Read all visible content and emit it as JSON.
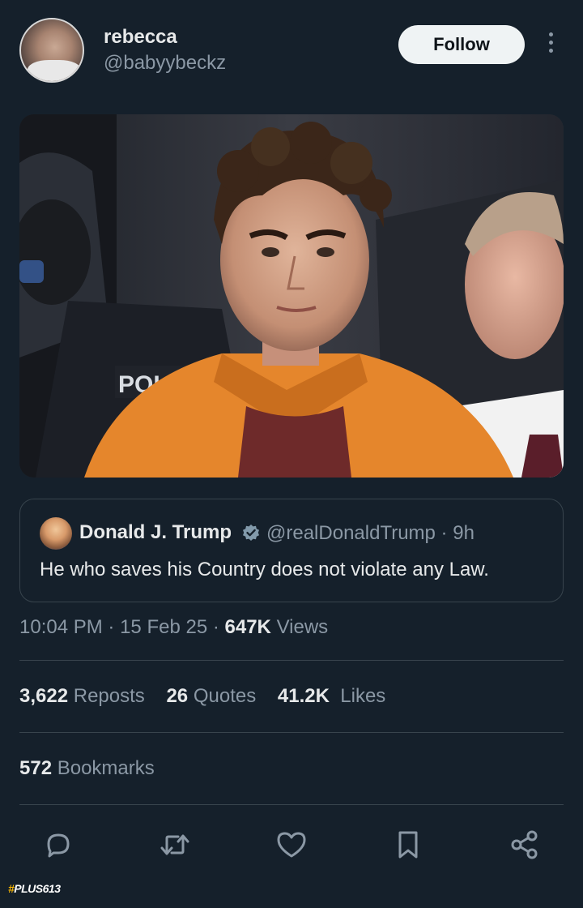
{
  "author": {
    "name": "rebecca",
    "handle": "@babyybeckz",
    "follow_label": "Follow"
  },
  "quoted": {
    "name": "Donald J. Trump",
    "handle": "@realDonaldTrump · 9h",
    "text": "He who saves his Country does not violate any Law."
  },
  "meta": {
    "time": "10:04 PM",
    "date": "15 Feb 25",
    "views_count": "647K",
    "views_label": "Views"
  },
  "stats": {
    "reposts_count": "3,622",
    "reposts_label": "Reposts",
    "quotes_count": "26",
    "quotes_label": "Quotes",
    "likes_count": "41.2K",
    "likes_label": "Likes",
    "bookmarks_count": "572",
    "bookmarks_label": "Bookmarks"
  },
  "media": {
    "badge_text": "POLIC"
  },
  "actions": [
    {
      "icon": "reply-icon"
    },
    {
      "icon": "repost-icon"
    },
    {
      "icon": "like-icon"
    },
    {
      "icon": "bookmark-icon"
    },
    {
      "icon": "share-icon"
    }
  ],
  "watermark": {
    "hash": "#",
    "text": "PLUS613"
  },
  "colors": {
    "background": "#15202b",
    "text": "#e7e9ea",
    "muted": "#8b98a5",
    "border": "#38444d",
    "verified": "#829aab"
  }
}
